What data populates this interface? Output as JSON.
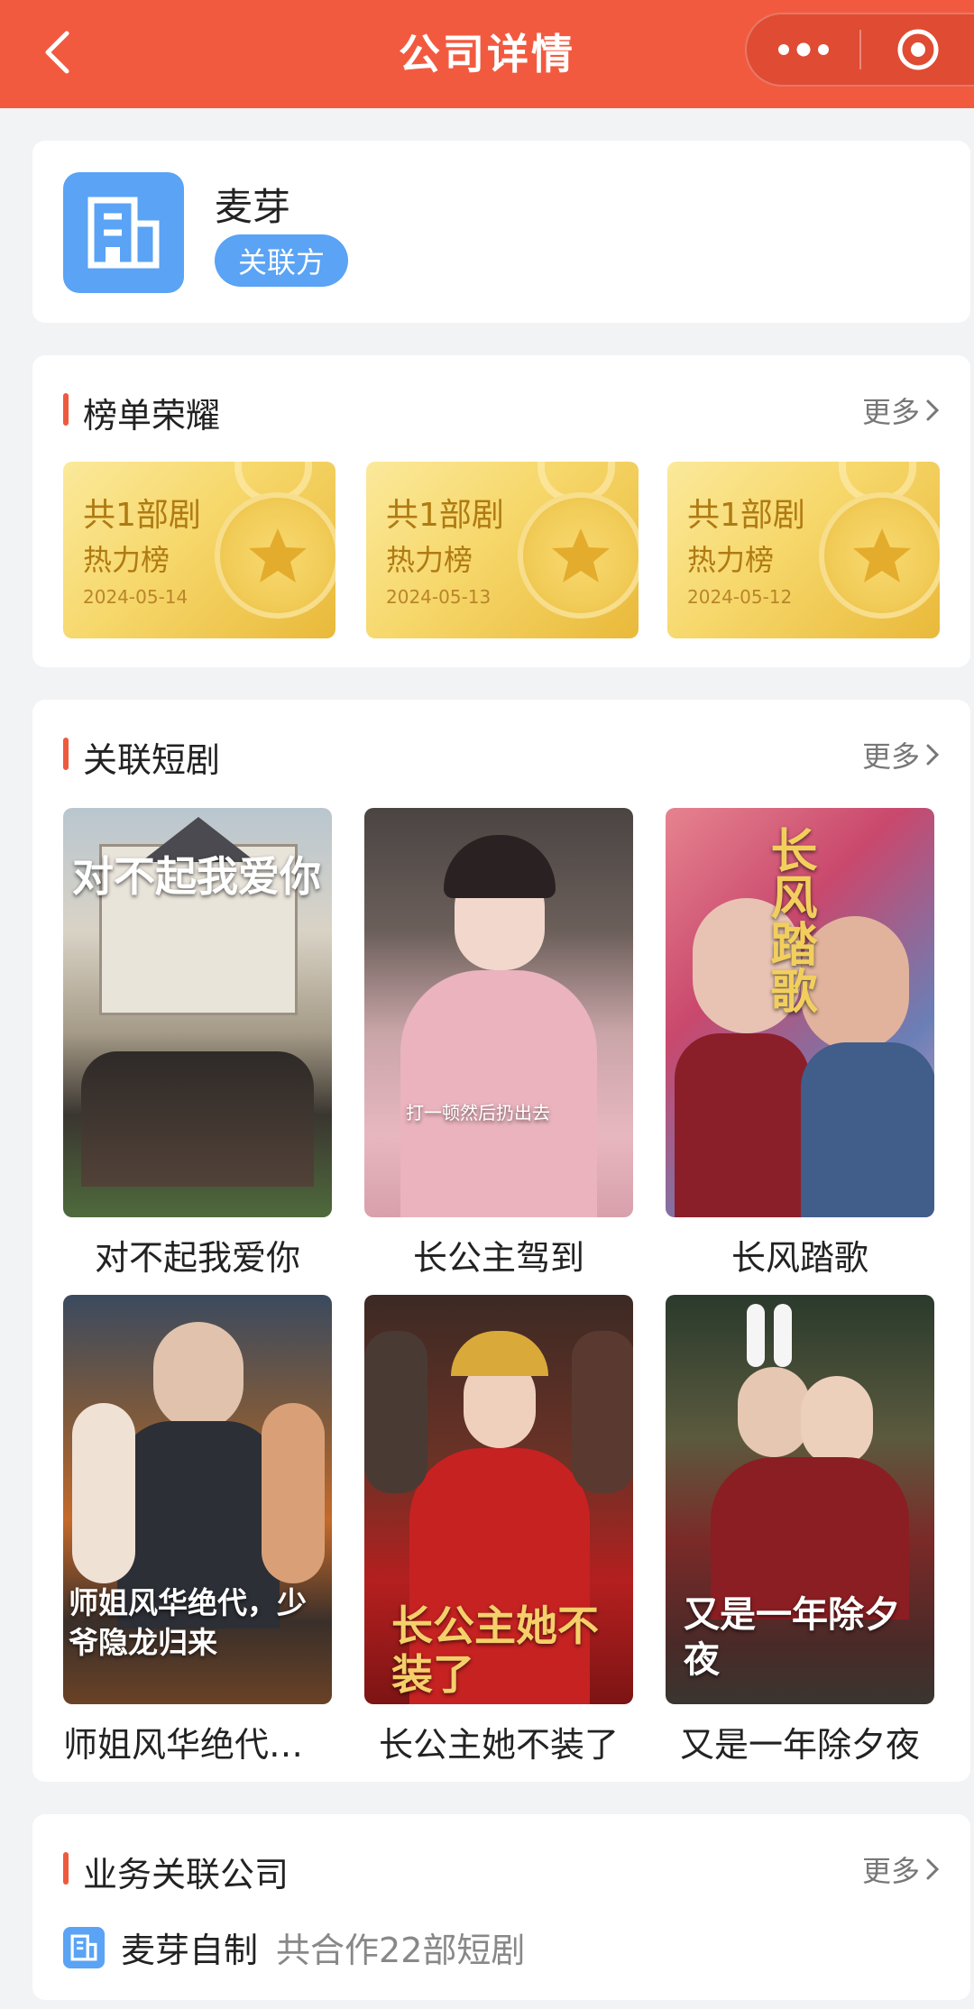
{
  "header": {
    "title": "公司详情",
    "bg_color": "#f25a40"
  },
  "company": {
    "name": "麦芽",
    "badge": "关联方",
    "logo_icon": "building-icon",
    "accent": "#5aa3f5"
  },
  "rankings": {
    "section_title": "榜单荣耀",
    "more": "更多",
    "items": [
      {
        "count": "共1部剧",
        "list": "热力榜",
        "date": "2024-05-14"
      },
      {
        "count": "共1部剧",
        "list": "热力榜",
        "date": "2024-05-13"
      },
      {
        "count": "共1部剧",
        "list": "热力榜",
        "date": "2024-05-12"
      }
    ]
  },
  "shows": {
    "section_title": "关联短剧",
    "more": "更多",
    "items": [
      {
        "title": "对不起我爱你",
        "poster_text": "对不起我爱你"
      },
      {
        "title": "长公主驾到",
        "poster_text": "打一顿然后扔出去"
      },
      {
        "title": "长风踏歌",
        "poster_text": "长风踏歌"
      },
      {
        "title": "师姐风华绝代…",
        "poster_text": "师姐风华绝代，少爷隐龙归来"
      },
      {
        "title": "长公主她不装了",
        "poster_text": "长公主她不装了"
      },
      {
        "title": "又是一年除夕夜",
        "poster_text": "又是一年除夕夜"
      }
    ]
  },
  "partners": {
    "section_title": "业务关联公司",
    "more": "更多",
    "items": [
      {
        "name": "麦芽自制",
        "count": "共合作22部短剧"
      }
    ]
  }
}
